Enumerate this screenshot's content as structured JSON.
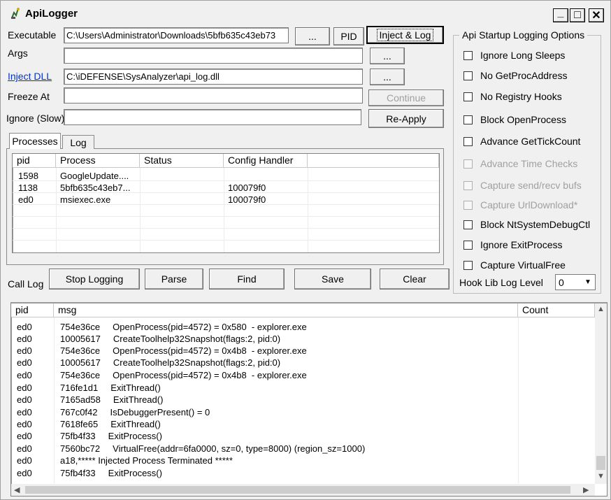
{
  "window": {
    "title": "ApiLogger"
  },
  "titlebar": {
    "minimize": "_",
    "maximize": "□",
    "close": "✕"
  },
  "form": {
    "executable_label": "Executable",
    "executable_value": "C:\\Users\\Administrator\\Downloads\\5bfb635c43eb73",
    "args_label": "Args",
    "args_value": "",
    "inject_dll_label": "Inject DLL",
    "inject_dll_value": "C:\\iDEFENSE\\SysAnalyzer\\api_log.dll",
    "freeze_at_label": "Freeze At",
    "freeze_at_value": "",
    "ignore_label": "Ignore (Slow)",
    "ignore_value": ""
  },
  "buttons": {
    "browse": "...",
    "pid": "PID",
    "inject_log": "Inject & Log",
    "continue": "Continue",
    "reapply": "Re-Apply",
    "stop_logging": "Stop Logging",
    "parse": "Parse",
    "find": "Find",
    "save": "Save",
    "clear": "Clear"
  },
  "tabs": {
    "processes": "Processes",
    "log": "Log"
  },
  "processes": {
    "columns": [
      "pid",
      "Process",
      "Status",
      "Config Handler"
    ],
    "rows": [
      [
        "1598",
        "GoogleUpdate....",
        "",
        ""
      ],
      [
        "1138",
        "5bfb635c43eb7...",
        "",
        "100079f0"
      ],
      [
        "ed0",
        "msiexec.exe",
        "",
        "100079f0"
      ]
    ]
  },
  "options": {
    "title": "Api Startup Logging Options",
    "items": [
      {
        "label": "Ignore Long Sleeps",
        "enabled": true
      },
      {
        "label": "No GetProcAddress",
        "enabled": true
      },
      {
        "label": "No Registry Hooks",
        "enabled": true
      },
      {
        "label": "Block OpenProcess",
        "enabled": true
      },
      {
        "label": "Advance GetTickCount",
        "enabled": true
      },
      {
        "label": "Advance Time Checks",
        "enabled": false
      },
      {
        "label": "Capture send/recv bufs",
        "enabled": false
      },
      {
        "label": "Capture UrlDownload*",
        "enabled": false
      },
      {
        "label": "Block NtSystemDebugCtl",
        "enabled": true
      },
      {
        "label": "Ignore ExitProcess",
        "enabled": true
      },
      {
        "label": "Capture VirtualFree",
        "enabled": true
      }
    ],
    "hook_level_label": "Hook Lib Log Level",
    "hook_level_value": "0"
  },
  "calllog": {
    "label": "Call Log",
    "columns": [
      "pid",
      "msg",
      "Count"
    ],
    "rows": [
      [
        "ed0",
        "754e36ce     OpenProcess(pid=4572) = 0x580  - explorer.exe"
      ],
      [
        "ed0",
        "10005617     CreateToolhelp32Snapshot(flags:2, pid:0)"
      ],
      [
        "ed0",
        "754e36ce     OpenProcess(pid=4572) = 0x4b8  - explorer.exe"
      ],
      [
        "ed0",
        "10005617     CreateToolhelp32Snapshot(flags:2, pid:0)"
      ],
      [
        "ed0",
        "754e36ce     OpenProcess(pid=4572) = 0x4b8  - explorer.exe"
      ],
      [
        "ed0",
        "716fe1d1     ExitThread()"
      ],
      [
        "ed0",
        "7165ad58     ExitThread()"
      ],
      [
        "ed0",
        "767c0f42     IsDebuggerPresent() = 0"
      ],
      [
        "ed0",
        "7618fe65     ExitThread()"
      ],
      [
        "ed0",
        "75fb4f33     ExitProcess()"
      ],
      [
        "ed0",
        "7560bc72     VirtualFree(addr=6fa0000, sz=0, type=8000) (region_sz=1000)"
      ],
      [
        "ed0",
        "a18,***** Injected Process Terminated *****"
      ],
      [
        "ed0",
        "75fb4f33     ExitProcess()"
      ]
    ]
  },
  "icons": {
    "scroll_up": "▲",
    "scroll_down": "▼",
    "scroll_left": "◀",
    "scroll_right": "▶",
    "dropdown": "▼"
  }
}
